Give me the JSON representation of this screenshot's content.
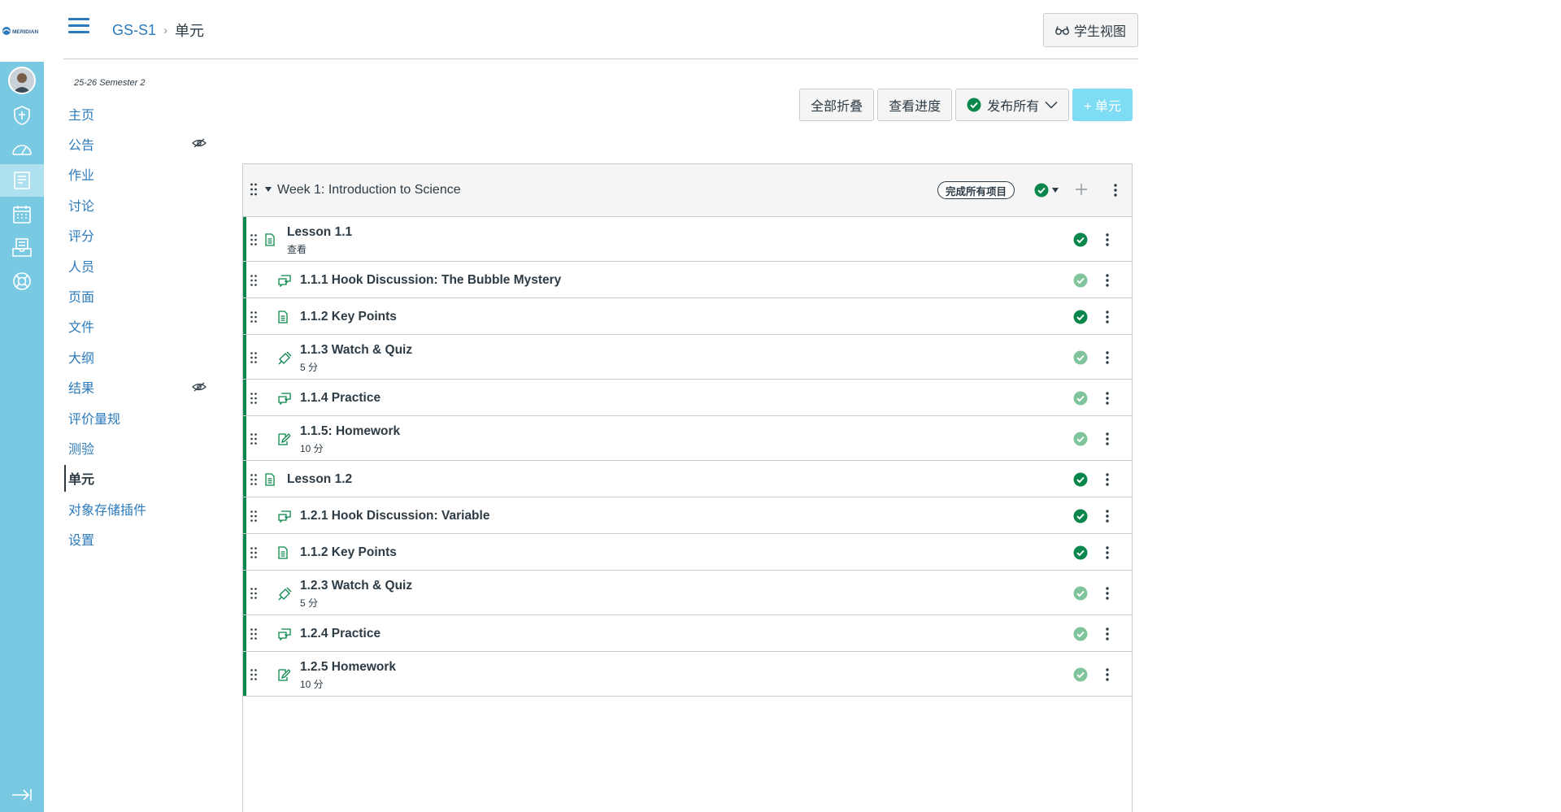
{
  "global_nav": {
    "logo_text": "MERIDIAN",
    "items": [
      {
        "name": "account"
      },
      {
        "name": "admin"
      },
      {
        "name": "dashboard"
      },
      {
        "name": "courses",
        "active": true
      },
      {
        "name": "calendar"
      },
      {
        "name": "inbox"
      },
      {
        "name": "help"
      }
    ]
  },
  "header": {
    "breadcrumb_course": "GS-S1",
    "breadcrumb_separator": "›",
    "breadcrumb_current": "单元",
    "student_view_label": "学生视图"
  },
  "course_nav": {
    "term": "25-26 Semester 2",
    "items": [
      {
        "label": "主页"
      },
      {
        "label": "公告",
        "hidden": true
      },
      {
        "label": "作业"
      },
      {
        "label": "讨论"
      },
      {
        "label": "评分"
      },
      {
        "label": "人员"
      },
      {
        "label": "页面"
      },
      {
        "label": "文件"
      },
      {
        "label": "大纲"
      },
      {
        "label": "结果",
        "hidden": true
      },
      {
        "label": "评价量规"
      },
      {
        "label": "测验"
      },
      {
        "label": "单元",
        "active": true
      },
      {
        "label": "对象存储插件"
      },
      {
        "label": "设置"
      }
    ]
  },
  "toolbar": {
    "collapse_all": "全部折叠",
    "view_progress": "查看进度",
    "publish_all": "发布所有",
    "add_module": "+ 单元"
  },
  "module": {
    "title": "Week 1: Introduction to Science",
    "requirement": "完成所有项目",
    "items": [
      {
        "title": "Lesson 1.1",
        "meta": "查看",
        "type": "page",
        "indent": 0,
        "published": "dark"
      },
      {
        "title": "1.1.1 Hook Discussion: The Bubble Mystery",
        "meta": "",
        "type": "discussion",
        "indent": 1,
        "published": "light"
      },
      {
        "title": "1.1.2 Key Points",
        "meta": "",
        "type": "page",
        "indent": 1,
        "published": "dark"
      },
      {
        "title": "1.1.3 Watch & Quiz",
        "meta": "5 分",
        "type": "quiz",
        "indent": 1,
        "published": "light"
      },
      {
        "title": "1.1.4 Practice",
        "meta": "",
        "type": "discussion",
        "indent": 1,
        "published": "light"
      },
      {
        "title": "1.1.5: Homework",
        "meta": "10 分",
        "type": "assignment",
        "indent": 1,
        "published": "light"
      },
      {
        "title": "Lesson 1.2",
        "meta": "",
        "type": "page",
        "indent": 0,
        "published": "dark"
      },
      {
        "title": "1.2.1 Hook Discussion: Variable",
        "meta": "",
        "type": "discussion",
        "indent": 1,
        "published": "dark"
      },
      {
        "title": "1.1.2 Key Points",
        "meta": "",
        "type": "page",
        "indent": 1,
        "published": "dark"
      },
      {
        "title": "1.2.3 Watch & Quiz",
        "meta": "5 分",
        "type": "quiz",
        "indent": 1,
        "published": "light"
      },
      {
        "title": "1.2.4 Practice",
        "meta": "",
        "type": "discussion",
        "indent": 1,
        "published": "light"
      },
      {
        "title": "1.2.5 Homework",
        "meta": "10 分",
        "type": "assignment",
        "indent": 1,
        "published": "light"
      }
    ]
  },
  "colors": {
    "link": "#2b7abc",
    "nav_bg": "#7ac9e3",
    "published_dark": "#0b874b",
    "published_light": "#7fc49b",
    "primary_button": "#7fdcf5"
  }
}
